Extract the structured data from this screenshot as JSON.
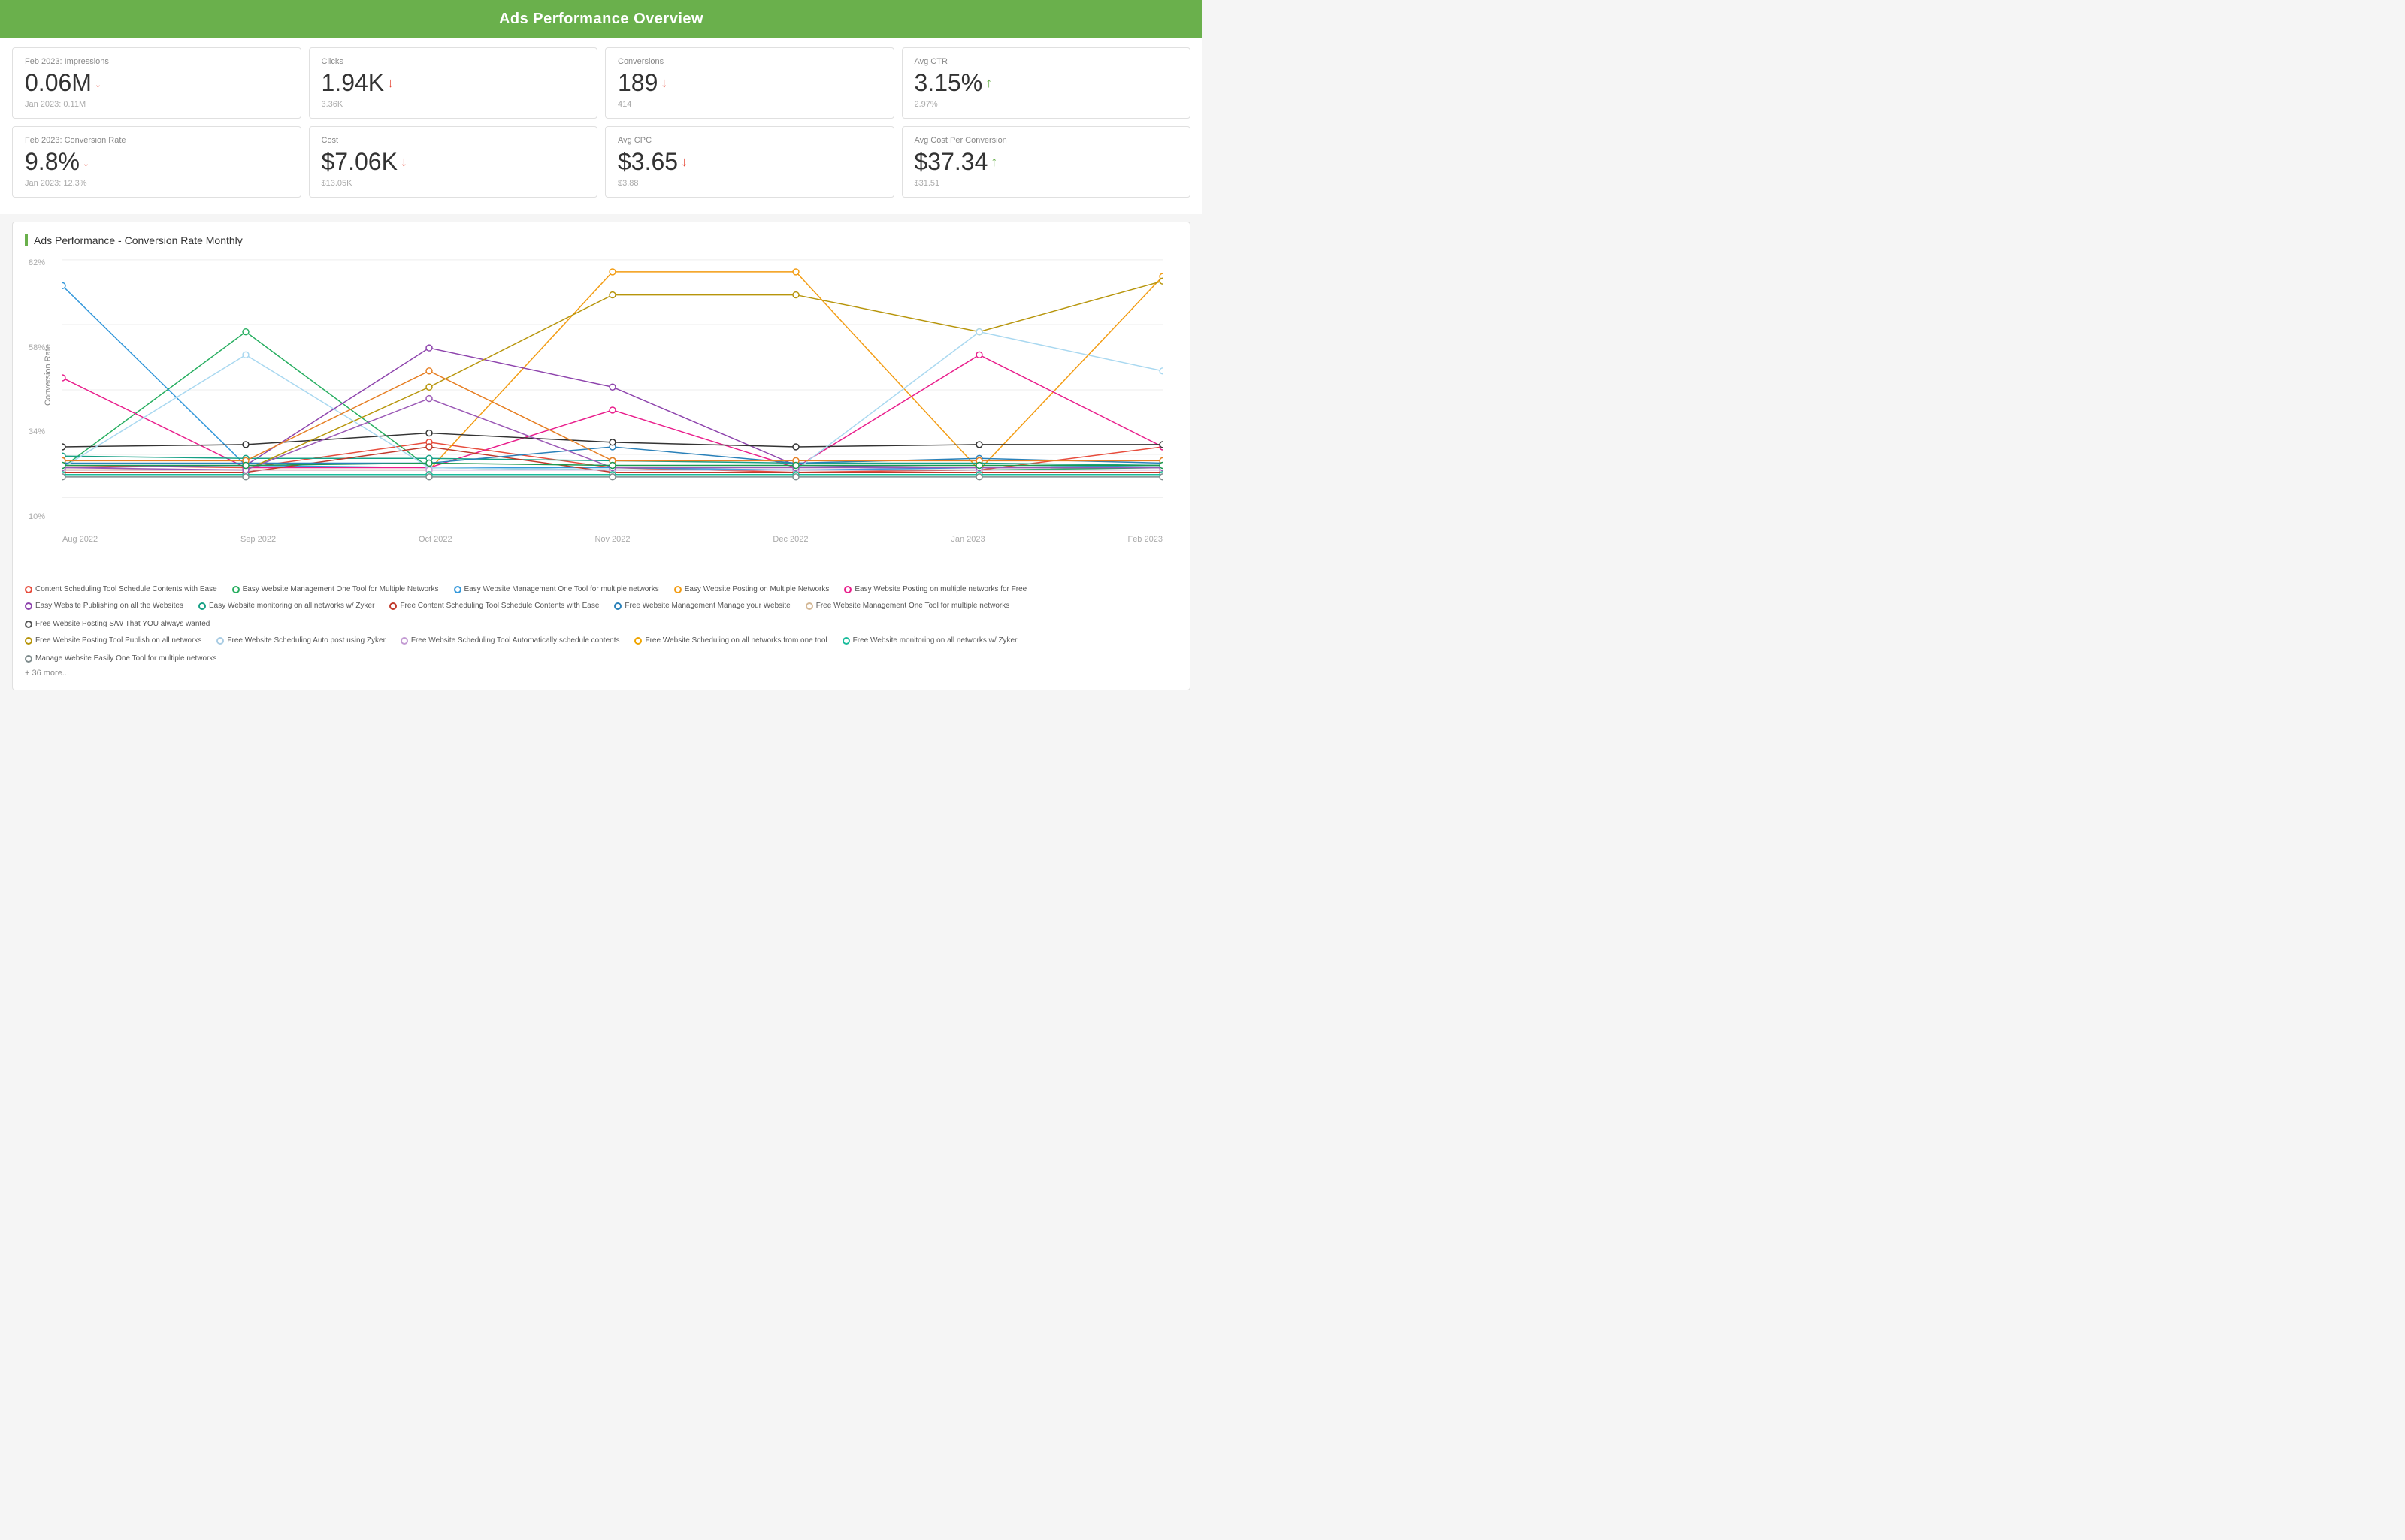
{
  "header": {
    "title": "Ads Performance Overview"
  },
  "metrics_row1": [
    {
      "label": "Feb 2023: Impressions",
      "value": "0.06M",
      "direction": "down",
      "prev_label": "Jan 2023: 0.11M"
    },
    {
      "label": "Clicks",
      "value": "1.94K",
      "direction": "down",
      "prev_label": "3.36K"
    },
    {
      "label": "Conversions",
      "value": "189",
      "direction": "down",
      "prev_label": "414"
    },
    {
      "label": "Avg CTR",
      "value": "3.15%",
      "direction": "up",
      "prev_label": "2.97%"
    }
  ],
  "metrics_row2": [
    {
      "label": "Feb 2023: Conversion Rate",
      "value": "9.8%",
      "direction": "down",
      "prev_label": "Jan 2023: 12.3%"
    },
    {
      "label": "Cost",
      "value": "$7.06K",
      "direction": "down",
      "prev_label": "$13.05K"
    },
    {
      "label": "Avg CPC",
      "value": "$3.65",
      "direction": "down",
      "prev_label": "$3.88"
    },
    {
      "label": "Avg Cost Per Conversion",
      "value": "$37.34",
      "direction": "up",
      "prev_label": "$31.51"
    }
  ],
  "chart": {
    "title": "Ads Performance - Conversion Rate Monthly",
    "y_label": "Conversion Rate",
    "y_axis": [
      "82%",
      "58%",
      "34%",
      "10%"
    ],
    "x_axis": [
      "Aug 2022",
      "Sep 2022",
      "Oct 2022",
      "Nov 2022",
      "Dec 2022",
      "Jan 2023",
      "Feb 2023"
    ],
    "more_label": "+ 36 more..."
  },
  "legend": {
    "items": [
      {
        "label": "Content Scheduling Tool Schedule Contents with Ease",
        "color": "#e74c3c"
      },
      {
        "label": "Easy Website Management One Tool for Multiple Networks",
        "color": "#27ae60"
      },
      {
        "label": "Easy Website Management One Tool for multiple networks",
        "color": "#3498db"
      },
      {
        "label": "Easy Website Posting on Multiple Networks",
        "color": "#f39c12"
      },
      {
        "label": "Easy Website Posting on multiple networks for Free",
        "color": "#e91e8c"
      },
      {
        "label": "Easy Website Publishing on all the Websites",
        "color": "#8e44ad"
      },
      {
        "label": "Easy Website monitoring on all networks w/ Zyker",
        "color": "#16a085"
      },
      {
        "label": "Free Content Scheduling Tool Schedule Contents with Ease",
        "color": "#c0392b"
      },
      {
        "label": "Free Website Management Manage your Website",
        "color": "#2980b9"
      },
      {
        "label": "Free Website Management One Tool for multiple networks",
        "color": "#d4b896"
      },
      {
        "label": "Free Website Posting S/W That YOU always wanted",
        "color": "#555"
      },
      {
        "label": "Free Website Posting Tool Publish on all networks",
        "color": "#b7950b"
      },
      {
        "label": "Free Website Scheduling Auto post using Zyker",
        "color": "#a9cce3"
      },
      {
        "label": "Free Website Scheduling Tool Automatically schedule contents",
        "color": "#c39bd3"
      },
      {
        "label": "Free Website Scheduling on all networks from one tool",
        "color": "#f0a500"
      },
      {
        "label": "Free Website monitoring on all networks w/ Zyker",
        "color": "#1abc9c"
      },
      {
        "label": "Manage Website Easily One Tool for multiple networks",
        "color": "#7f8c8d"
      }
    ]
  }
}
